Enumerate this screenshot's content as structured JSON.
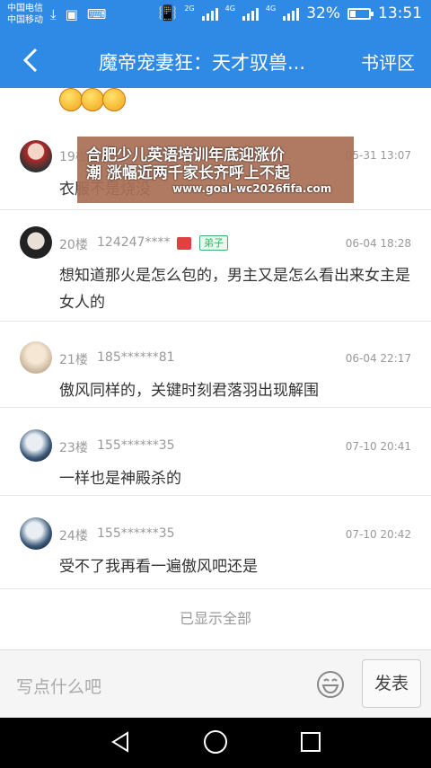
{
  "status": {
    "carrier1": "中国电信",
    "carrier2": "中国移动",
    "net1": "2G",
    "net2": "4G",
    "net3": "4G",
    "battery": "32%",
    "battery_level": 0.32,
    "time": "13:51"
  },
  "header": {
    "title": "魔帝宠妻狂：天才驭兽...",
    "review_label": "书评区"
  },
  "comments": [
    {
      "floor": "19楼",
      "user": "",
      "time": "05-31 13:07",
      "text": "衣服不是烧没"
    },
    {
      "floor": "20楼",
      "user": "124247****",
      "badge": "弟子",
      "time": "06-04 18:28",
      "text": "想知道那火是怎么包的，男主又是怎么看出来女主是女人的"
    },
    {
      "floor": "21楼",
      "user": "185******81",
      "time": "06-04 22:17",
      "text": "傲风同样的，关键时刻君落羽出现解围"
    },
    {
      "floor": "23楼",
      "user": "155******35",
      "time": "07-10 20:41",
      "text": "一样也是神殿杀的"
    },
    {
      "floor": "24楼",
      "user": "155******35",
      "time": "07-10 20:42",
      "text": "受不了我再看一遍傲风吧还是"
    }
  ],
  "ad": {
    "line1": "合肥少儿英语培训年底迎涨价",
    "line2": "潮 涨幅近两千家长齐呼上不起",
    "url": "www.goal-wc2026fifa.com"
  },
  "footer": {
    "shown_all": "已显示全部",
    "input_placeholder": "写点什么吧",
    "send_label": "发表"
  },
  "colors": {
    "accent": "#2f8ae6",
    "badge_green": "#3cb56b",
    "ad_bg": "#aa7056"
  }
}
